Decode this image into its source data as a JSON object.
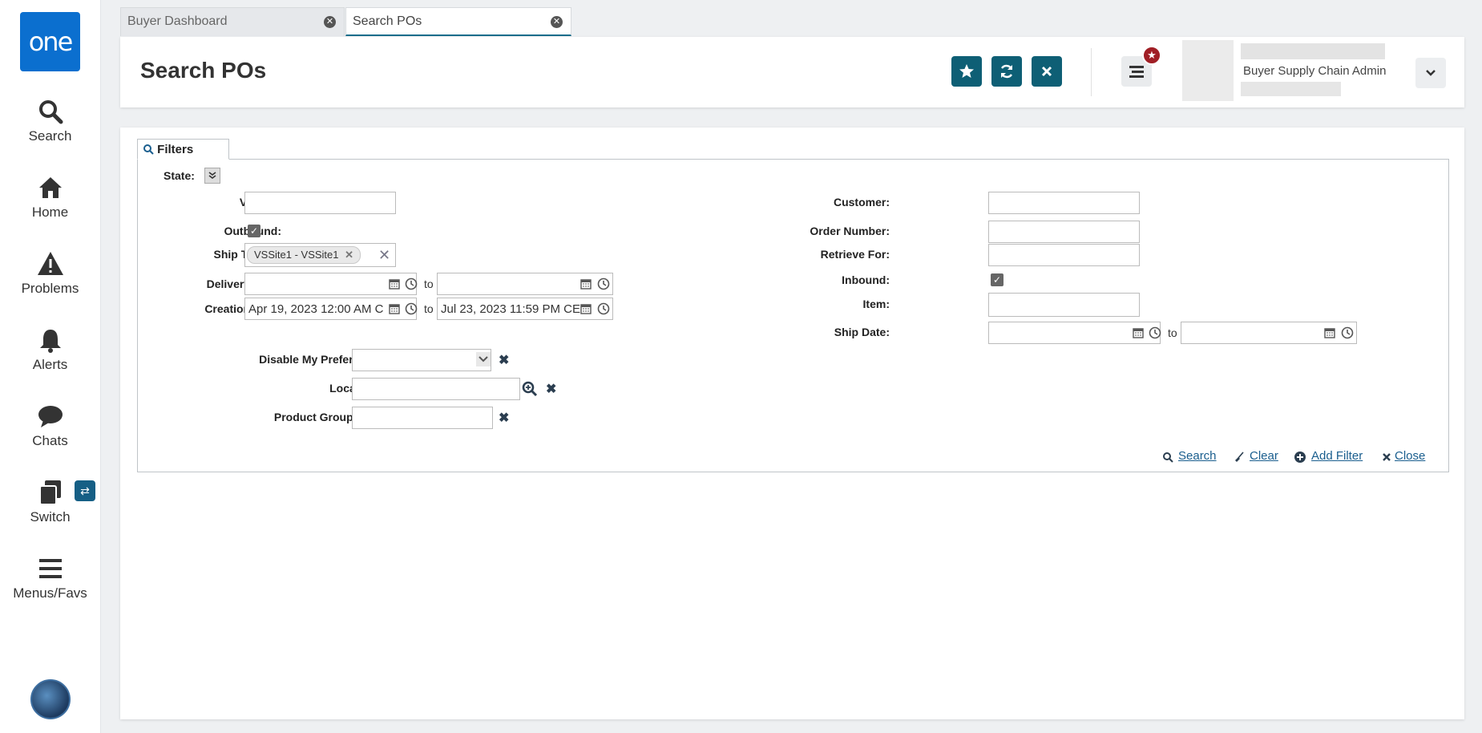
{
  "sidebar": {
    "logo": "one",
    "items": [
      {
        "label": "Search",
        "icon": "search-icon"
      },
      {
        "label": "Home",
        "icon": "home-icon"
      },
      {
        "label": "Problems",
        "icon": "warning-icon"
      },
      {
        "label": "Alerts",
        "icon": "bell-icon"
      },
      {
        "label": "Chats",
        "icon": "chat-icon"
      },
      {
        "label": "Switch",
        "icon": "switch-icon"
      },
      {
        "label": "Menus/Favs",
        "icon": "hamburger-icon"
      }
    ]
  },
  "tabs": [
    {
      "label": "Buyer Dashboard",
      "active": false
    },
    {
      "label": "Search POs",
      "active": true
    }
  ],
  "header": {
    "title": "Search POs",
    "user_name": "Buyer Supply Chain Admin"
  },
  "filters": {
    "tab_label": "Filters",
    "state_label": "State:",
    "vendor_label": "Vendor:",
    "vendor_value": "",
    "outbound_label": "Outbound:",
    "outbound_checked": true,
    "ship_to_site_label": "Ship To Site:",
    "ship_to_site_chip": "VSSite1 - VSSite1",
    "delivery_date_label": "Delivery Date:",
    "delivery_date_from": "",
    "delivery_date_to": "",
    "creation_date_label": "Creation Date:",
    "creation_date_from": "Apr 19, 2023 12:00 AM C",
    "creation_date_to": "Jul 23, 2023 11:59 PM CE",
    "to_label": "to",
    "customer_label": "Customer:",
    "order_number_label": "Order Number:",
    "retrieve_for_label": "Retrieve For:",
    "inbound_label": "Inbound:",
    "inbound_checked": true,
    "item_label": "Item:",
    "ship_date_label": "Ship Date:",
    "disable_prefs_label": "Disable My Preferences:",
    "local_item_label": "Local Item:",
    "product_group_label": "Product Group Level:"
  },
  "actions": {
    "search": "Search",
    "clear": "Clear",
    "add_filter": "Add Filter",
    "close": "Close"
  },
  "colors": {
    "accent": "#0e5f75",
    "logo": "#0b6fcf",
    "notification": "#a01e25",
    "link": "#1a5e8e"
  }
}
